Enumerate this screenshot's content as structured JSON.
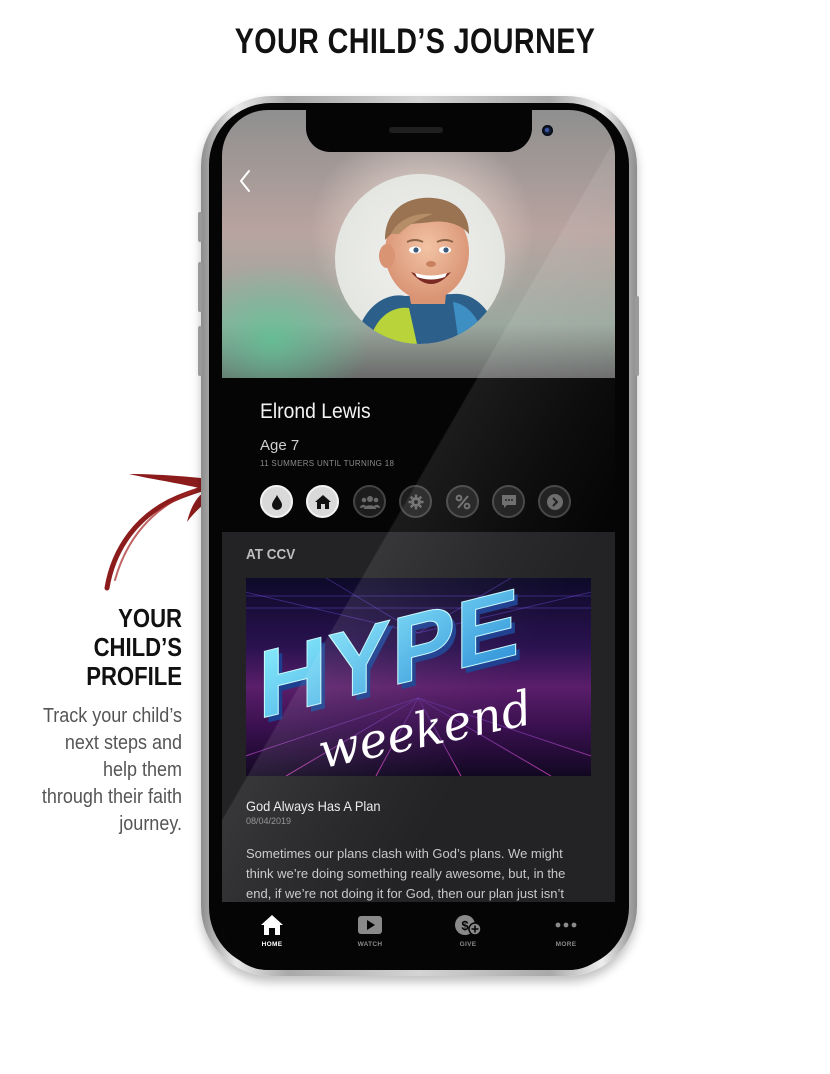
{
  "page": {
    "heading": "YOUR CHILD’S JOURNEY"
  },
  "callout": {
    "title_lines": [
      "YOUR",
      "CHILD’S",
      "PROFILE"
    ],
    "body": "Track your child’s next steps and help them through their faith journey.",
    "accent_color": "#8c1c1c"
  },
  "app": {
    "profile": {
      "name": "Elrond Lewis",
      "age": "Age 7",
      "subtitle": "11 SUMMERS UNTIL TURNING 18",
      "step_icons": [
        {
          "icon": "water-drop-icon",
          "active": true
        },
        {
          "icon": "church-icon",
          "active": true
        },
        {
          "icon": "group-icon",
          "active": false
        },
        {
          "icon": "gear-icon",
          "active": false
        },
        {
          "icon": "percent-icon",
          "active": false
        },
        {
          "icon": "chat-icon",
          "active": false
        },
        {
          "icon": "chevron-right-icon",
          "active": false
        }
      ]
    },
    "section": {
      "label": "AT CCV"
    },
    "feature": {
      "banner_title": "HYPE",
      "banner_subtitle": "weekend",
      "title": "God Always Has A Plan",
      "date": "08/04/2019",
      "body": "Sometimes our plans clash with God’s plans. We might think we’re doing something really awesome, but, in the end, if we’re not doing it for God, then our plan just isn’t"
    },
    "tabs": [
      {
        "label": "HOME",
        "icon": "home-icon",
        "active": true
      },
      {
        "label": "WATCH",
        "icon": "play-icon",
        "active": false
      },
      {
        "label": "GIVE",
        "icon": "give-icon",
        "active": false
      },
      {
        "label": "MORE",
        "icon": "more-icon",
        "active": false
      }
    ]
  }
}
